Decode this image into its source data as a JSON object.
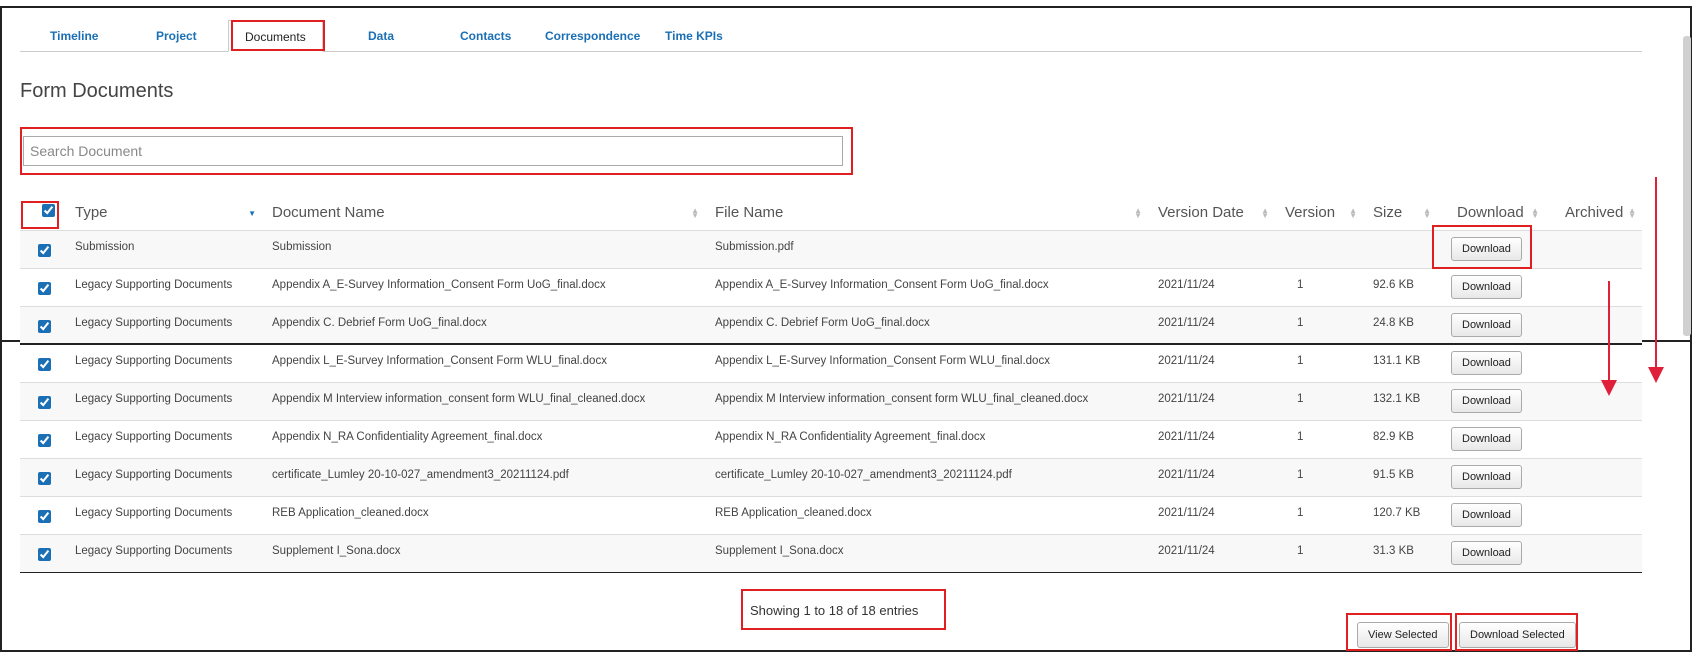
{
  "tabs": [
    {
      "label": "Timeline"
    },
    {
      "label": "Project"
    },
    {
      "label": "Documents"
    },
    {
      "label": "Data"
    },
    {
      "label": "Contacts"
    },
    {
      "label": "Correspondence"
    },
    {
      "label": "Time KPIs"
    }
  ],
  "active_tab": "Documents",
  "page_title": "Form Documents",
  "search": {
    "placeholder": "Search Document",
    "value": ""
  },
  "table": {
    "columns": [
      "Type",
      "Document Name",
      "File Name",
      "Version Date",
      "Version",
      "Size",
      "Download",
      "Archived"
    ],
    "rows": [
      {
        "type": "Submission",
        "document_name": "Submission",
        "file_name": "Submission.pdf",
        "version_date": "",
        "version": "",
        "size": "",
        "download": "Download",
        "checked": true
      },
      {
        "type": "Legacy Supporting Documents",
        "document_name": "Appendix A_E-Survey Information_Consent Form UoG_final.docx",
        "file_name": "Appendix A_E-Survey Information_Consent Form UoG_final.docx",
        "version_date": "2021/11/24",
        "version": "1",
        "size": "92.6 KB",
        "download": "Download",
        "checked": true
      },
      {
        "type": "Legacy Supporting Documents",
        "document_name": "Appendix C. Debrief Form UoG_final.docx",
        "file_name": "Appendix C. Debrief Form UoG_final.docx",
        "version_date": "2021/11/24",
        "version": "1",
        "size": "24.8 KB",
        "download": "Download",
        "checked": true
      },
      {
        "type": "Legacy Supporting Documents",
        "document_name": "Appendix L_E-Survey Information_Consent Form WLU_final.docx",
        "file_name": "Appendix L_E-Survey Information_Consent Form WLU_final.docx",
        "version_date": "2021/11/24",
        "version": "1",
        "size": "131.1 KB",
        "download": "Download",
        "checked": true
      },
      {
        "type": "Legacy Supporting Documents",
        "document_name": "Appendix M Interview information_consent form WLU_final_cleaned.docx",
        "file_name": "Appendix M Interview information_consent form WLU_final_cleaned.docx",
        "version_date": "2021/11/24",
        "version": "1",
        "size": "132.1 KB",
        "download": "Download",
        "checked": true
      },
      {
        "type": "Legacy Supporting Documents",
        "document_name": "Appendix N_RA Confidentiality Agreement_final.docx",
        "file_name": "Appendix N_RA Confidentiality Agreement_final.docx",
        "version_date": "2021/11/24",
        "version": "1",
        "size": "82.9 KB",
        "download": "Download",
        "checked": true
      },
      {
        "type": "Legacy Supporting Documents",
        "document_name": "certificate_Lumley 20-10-027_amendment3_20211124.pdf",
        "file_name": "certificate_Lumley 20-10-027_amendment3_20211124.pdf",
        "version_date": "2021/11/24",
        "version": "1",
        "size": "91.5 KB",
        "download": "Download",
        "checked": true
      },
      {
        "type": "Legacy Supporting Documents",
        "document_name": "REB Application_cleaned.docx",
        "file_name": "REB Application_cleaned.docx",
        "version_date": "2021/11/24",
        "version": "1",
        "size": "120.7 KB",
        "download": "Download",
        "checked": true
      },
      {
        "type": "Legacy Supporting Documents",
        "document_name": "Supplement I_Sona.docx",
        "file_name": "Supplement I_Sona.docx",
        "version_date": "2021/11/24",
        "version": "1",
        "size": "31.3 KB",
        "download": "Download",
        "checked": true
      }
    ]
  },
  "entries_info": "Showing 1 to 18 of 18 entries",
  "footer": {
    "view_selected": "View Selected",
    "download_selected": "Download Selected"
  },
  "colors": {
    "link": "#1b6fb4",
    "highlight": "#e02020",
    "arrow": "#e0203a"
  }
}
